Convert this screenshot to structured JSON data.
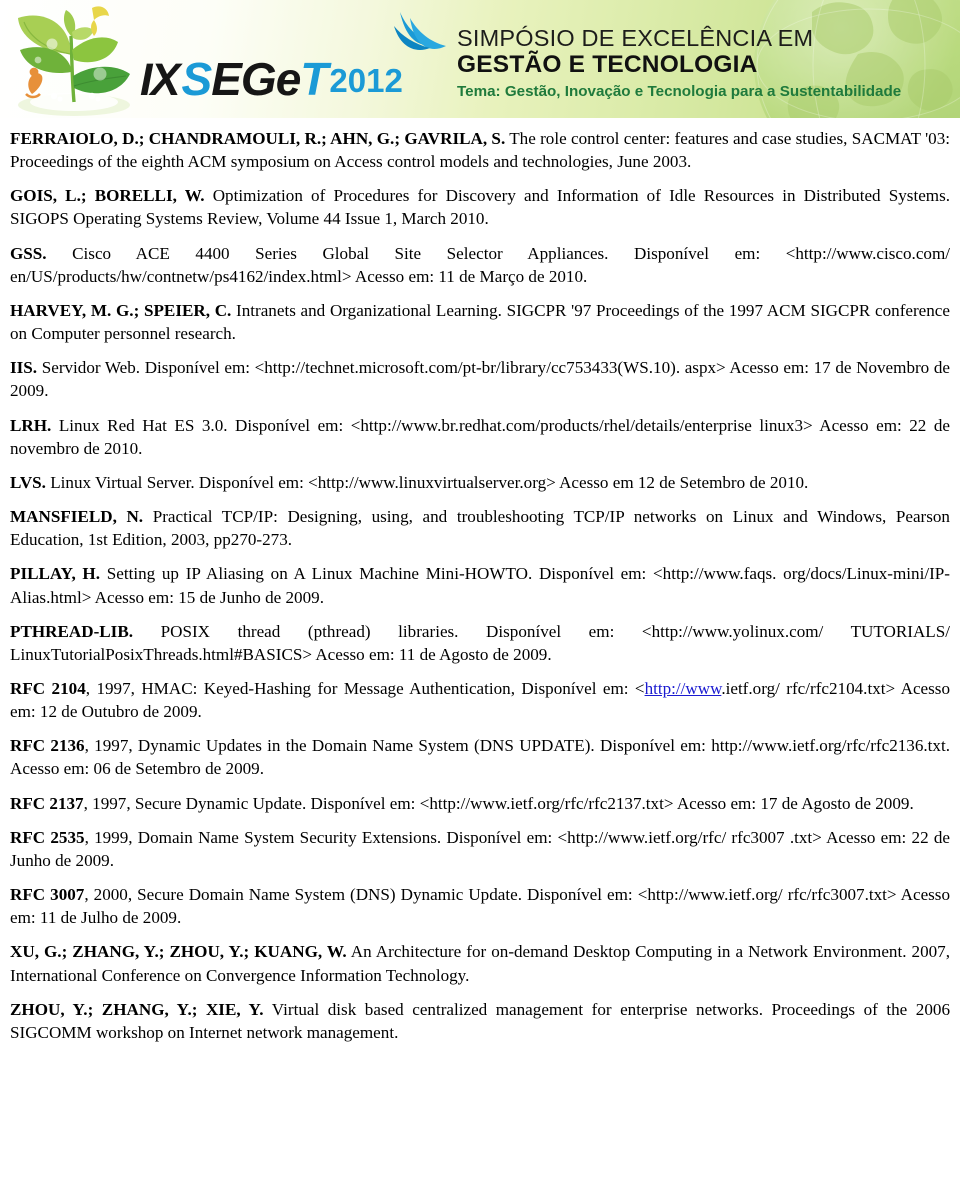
{
  "banner": {
    "logo": {
      "roman": "IX",
      "acronym_s": "S",
      "acronym_e": "E",
      "acronym_g": "G",
      "acronym_e2": "e",
      "acronym_t": "T",
      "year": "2012",
      "full": "IX SEGeT 2012"
    },
    "title_line1": "SIMPÓSIO DE EXCELÊNCIA EM",
    "title_line2": "GESTÃO E TECNOLOGIA",
    "theme": "Tema: Gestão, Inovação e Tecnologia para a Sustentabilidade",
    "colors": {
      "brand_blue": "#1b9ad6",
      "theme_green": "#1f7a3c",
      "banner_green": "#bcd982",
      "title_dark": "#1d1d1b"
    }
  },
  "references": [
    {
      "id": "ferraiolo",
      "authors": "FERRAIOLO, D.; CHANDRAMOULI, R.; AHN, G.; GAVRILA, S.",
      "body": " The role control center: features and case studies, SACMAT '03: Proceedings of the eighth ACM symposium on Access control models and technologies, June 2003."
    },
    {
      "id": "gois",
      "authors": "GOIS, L.; BORELLI, W.",
      "body": " Optimization of Procedures for Discovery and Information of Idle Resources in Distributed Systems. SIGOPS Operating Systems Review, Volume 44 Issue 1, March 2010."
    },
    {
      "id": "gss",
      "authors": "GSS.",
      "body": " Cisco ACE 4400 Series Global Site Selector Appliances. Disponível em: <http://www.cisco.com/ en/US/products/hw/contnetw/ps4162/index.html> Acesso em: 11 de Março de 2010."
    },
    {
      "id": "harvey",
      "authors": "HARVEY, M. G.; SPEIER, C.",
      "body": " Intranets and Organizational Learning. SIGCPR '97 Proceedings of the 1997 ACM SIGCPR conference on Computer personnel research."
    },
    {
      "id": "iis",
      "authors": "IIS.",
      "body": " Servidor Web. Disponível em: <http://technet.microsoft.com/pt-br/library/cc753433(WS.10). aspx> Acesso em: 17 de Novembro de 2009."
    },
    {
      "id": "lrh",
      "authors": "LRH.",
      "body": " Linux Red Hat ES 3.0. Disponível em: <http://www.br.redhat.com/products/rhel/details/enterprise linux3> Acesso em: 22 de novembro de 2010."
    },
    {
      "id": "lvs",
      "authors": "LVS.",
      "body": " Linux Virtual Server. Disponível em: <http://www.linuxvirtualserver.org> Acesso em 12 de Setembro de 2010."
    },
    {
      "id": "mansfield",
      "authors": "MANSFIELD, N.",
      "body": " Practical TCP/IP: Designing, using, and troubleshooting TCP/IP networks on Linux and Windows, Pearson Education, 1st Edition, 2003, pp270-273."
    },
    {
      "id": "pillay",
      "authors": "PILLAY, H.",
      "body": " Setting up IP Aliasing on A Linux Machine Mini-HOWTO. Disponível em: <http://www.faqs. org/docs/Linux-mini/IP-Alias.html> Acesso em: 15 de Junho de 2009."
    },
    {
      "id": "pthread",
      "authors": "PTHREAD-LIB.",
      "body": " POSIX thread (pthread) libraries. Disponível em: <http://www.yolinux.com/ TUTORIALS/ LinuxTutorialPosixThreads.html#BASICS> Acesso em: 11 de Agosto de 2009."
    },
    {
      "id": "rfc2104",
      "authors": "RFC 2104",
      "body_before_link": ", 1997, HMAC: Keyed-Hashing for Message Authentication, Disponível em: <",
      "link_text": "http://www",
      "body_after_link": ".ietf.org/ rfc/rfc2104.txt> Acesso em: 12 de Outubro de 2009."
    },
    {
      "id": "rfc2136",
      "authors": "RFC 2136",
      "body": ", 1997, Dynamic Updates in the Domain Name System (DNS UPDATE). Disponível em: http://www.ietf.org/rfc/rfc2136.txt. Acesso em: 06 de Setembro de 2009."
    },
    {
      "id": "rfc2137",
      "authors": "RFC 2137",
      "body": ", 1997, Secure Dynamic Update. Disponível em: <http://www.ietf.org/rfc/rfc2137.txt> Acesso em: 17 de Agosto de 2009."
    },
    {
      "id": "rfc2535",
      "authors": "RFC 2535",
      "body": ", 1999, Domain Name System Security Extensions. Disponível em: <http://www.ietf.org/rfc/ rfc3007 .txt> Acesso em: 22 de Junho de 2009."
    },
    {
      "id": "rfc3007",
      "authors": "RFC 3007",
      "body": ", 2000, Secure Domain Name System (DNS) Dynamic Update. Disponível em: <http://www.ietf.org/ rfc/rfc3007.txt> Acesso em: 11 de Julho de 2009."
    },
    {
      "id": "xu",
      "authors": "XU, G.; ZHANG, Y.; ZHOU, Y.; KUANG, W.",
      "body": " An Architecture for on-demand Desktop Computing in a Network Environment. 2007, International Conference on Convergence Information Technology."
    },
    {
      "id": "zhou",
      "authors": "ZHOU, Y.; ZHANG, Y.; XIE, Y.",
      "body": " Virtual disk based centralized management for enterprise networks. Proceedings of the 2006 SIGCOMM workshop on Internet network management."
    }
  ]
}
